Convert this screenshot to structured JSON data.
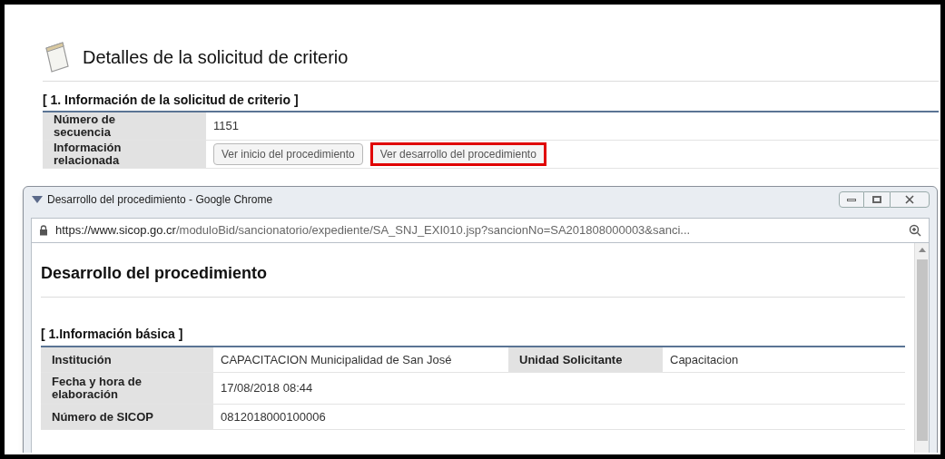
{
  "page": {
    "title": "Detalles de la solicitud de criterio",
    "section": "[ 1. Información de la solicitud de criterio ]",
    "rows": [
      {
        "label": "Número de secuencia",
        "value": "1151"
      },
      {
        "label": "Información relacionada",
        "buttons": [
          {
            "label": "Ver inicio del procedimiento",
            "highlighted": false
          },
          {
            "label": "Ver desarrollo del procedimiento",
            "highlighted": true
          }
        ]
      }
    ]
  },
  "popup": {
    "window_title": "Desarrollo del procedimiento - Google Chrome",
    "url_host": "https://www.sicop.go.cr",
    "url_path": "/moduloBid/sancionatorio/expediente/SA_SNJ_EXI010.jsp?sancionNo=SA201808000003&sanci...",
    "heading": "Desarrollo del procedimiento",
    "section": "[ 1.Información básica ]",
    "rows": [
      {
        "cells": [
          {
            "label": "Institución",
            "value": "CAPACITACION Municipalidad de San José"
          },
          {
            "label": "Unidad Solicitante",
            "value": "Capacitacion"
          }
        ]
      },
      {
        "cells": [
          {
            "label": "Fecha y hora de elaboración",
            "value": "17/08/2018 08:44"
          }
        ]
      },
      {
        "cells": [
          {
            "label": "Número de SICOP",
            "value": "0812018000100006"
          }
        ]
      }
    ]
  }
}
